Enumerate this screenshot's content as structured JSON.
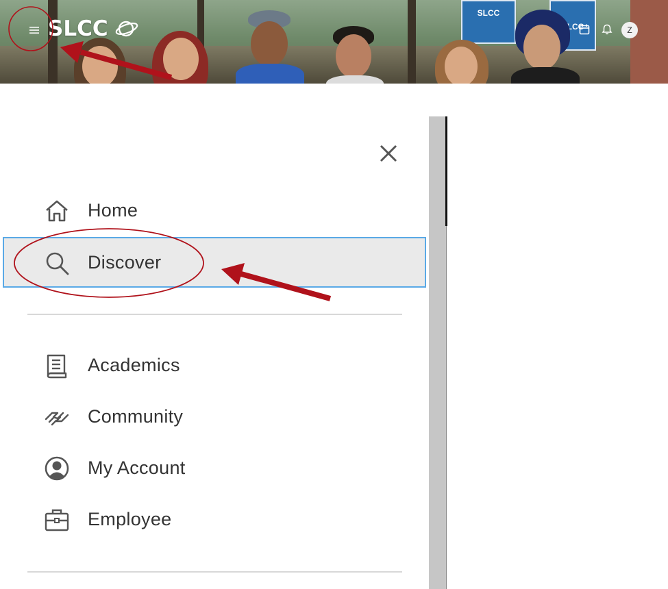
{
  "header": {
    "logo_text": "SLCC",
    "avatar_initial": "Z",
    "flag_text": "SLCC"
  },
  "drawer": {
    "primary": [
      {
        "label": "Home",
        "icon": "home-icon"
      },
      {
        "label": "Discover",
        "icon": "search-icon",
        "selected": true
      }
    ],
    "secondary": [
      {
        "label": "Academics",
        "icon": "book-icon"
      },
      {
        "label": "Community",
        "icon": "handshake-icon"
      },
      {
        "label": "My Account",
        "icon": "account-circle-icon"
      },
      {
        "label": "Employee",
        "icon": "briefcase-icon"
      }
    ]
  },
  "colors": {
    "annotation": "#b0121b",
    "selected_border": "#5aa9e6",
    "selected_bg": "#eaeaea"
  }
}
